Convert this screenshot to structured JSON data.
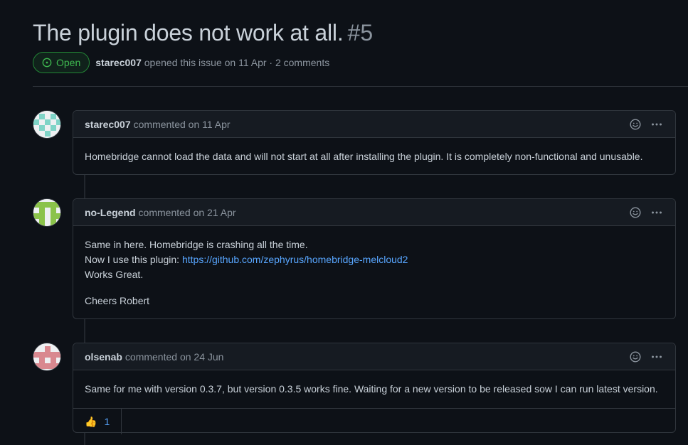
{
  "issue": {
    "title": "The plugin does not work at all.",
    "number": "#5",
    "state": "Open",
    "author": "starec007",
    "meta": "opened this issue on 11 Apr · 2 comments"
  },
  "comments": [
    {
      "author": "starec007",
      "action": "commented on 11 Apr",
      "body": [
        "Homebridge cannot load the data and will not start at all after installing the plugin. It is completely non-functional and unusable."
      ]
    },
    {
      "author": "no-Legend",
      "action": "commented on 21 Apr",
      "line1": "Same in here. Homebridge is crashing all the time.",
      "line2_prefix": "Now I use this plugin: ",
      "link": "https://github.com/zephyrus/homebridge-melcloud2",
      "line3": "Works Great.",
      "signoff": "Cheers Robert"
    },
    {
      "author": "olsenab",
      "action": "commented on 24 Jun",
      "body": [
        "Same for me with version 0.3.7, but version 0.3.5 works fine. Waiting for a new version to be released sow I can run latest version."
      ],
      "reactions": [
        {
          "emoji": "👍",
          "count": "1"
        }
      ]
    }
  ],
  "icons": {
    "open": "issue-opened-icon",
    "smiley": "smiley-icon",
    "more": "kebab-horizontal-icon"
  },
  "colors": {
    "background": "#0d1117",
    "header_bg": "#161b22",
    "border": "#30363d",
    "open_green": "#3fb950",
    "link_blue": "#58a6ff",
    "text": "#c9d1d9",
    "muted": "#8b949e"
  }
}
